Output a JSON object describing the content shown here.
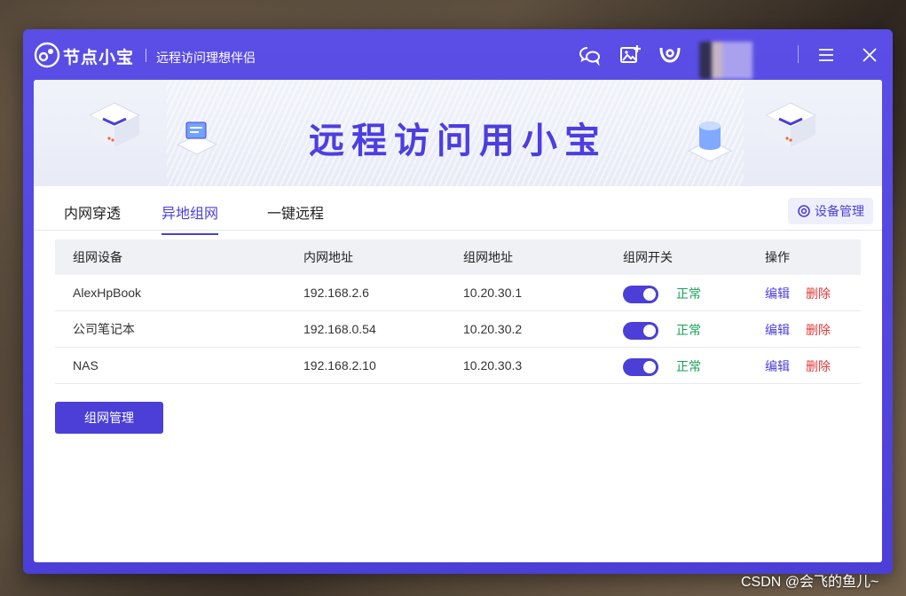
{
  "titlebar": {
    "app_name": "节点小宝",
    "subtitle": "远程访问理想伴侣",
    "icons": [
      "chat-icon",
      "add-image-icon",
      "brand-w-icon",
      "menu-icon",
      "close-icon"
    ]
  },
  "banner": {
    "title": "远程访问用小宝"
  },
  "tabs": [
    {
      "label": "内网穿透"
    },
    {
      "label": "异地组网"
    },
    {
      "label": "一键远程"
    }
  ],
  "active_tab": "异地组网",
  "device_manage_label": "设备管理",
  "table": {
    "headers": [
      "组网设备",
      "内网地址",
      "组网地址",
      "组网开关",
      "操作"
    ],
    "rows": [
      {
        "device": "AlexHpBook",
        "lan_ip": "192.168.2.6",
        "net_ip": "10.20.30.1",
        "switch_on": true,
        "status": "正常",
        "edit": "编辑",
        "delete": "删除"
      },
      {
        "device": "公司笔记本",
        "lan_ip": "192.168.0.54",
        "net_ip": "10.20.30.2",
        "switch_on": true,
        "status": "正常",
        "edit": "编辑",
        "delete": "删除"
      },
      {
        "device": "NAS",
        "lan_ip": "192.168.2.10",
        "net_ip": "10.20.30.3",
        "switch_on": true,
        "status": "正常",
        "edit": "编辑",
        "delete": "删除"
      }
    ]
  },
  "network_manage_button": "组网管理",
  "watermark": "CSDN @会飞的鱼儿~",
  "colors": {
    "accent": "#4b3fd8",
    "status_ok": "#18a058",
    "danger": "#e03a3a"
  }
}
